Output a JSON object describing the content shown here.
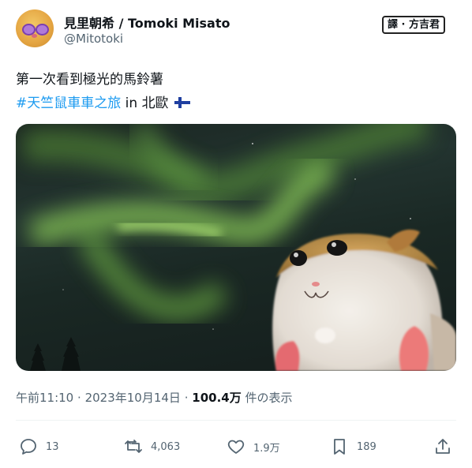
{
  "author": {
    "display_name": "見里朝希 / Tomoki Misato",
    "handle": "@Mitotoki",
    "avatar": "felt-hamster-avatar"
  },
  "translation_badge": "譯 · 方吉君",
  "post": {
    "line1": "第一次看到極光的馬鈴薯",
    "hashtag": "#天竺鼠車車之旅",
    "location_prefix": "in",
    "location": "北歐",
    "flag_icon": "finland-flag-icon"
  },
  "photo": {
    "description_icon": "aurora-photo",
    "colors": {
      "aurora": "#7ecb4d",
      "sky": "#1b2622"
    }
  },
  "meta": {
    "time": "午前11:10",
    "date": "2023年10月14日",
    "views": "100.4万",
    "views_label": "件の表示"
  },
  "actions": {
    "reply": {
      "icon": "reply-icon",
      "count": "13"
    },
    "retweet": {
      "icon": "retweet-icon",
      "count": "4,063"
    },
    "like": {
      "icon": "heart-icon",
      "count": "1.9万"
    },
    "bookmark": {
      "icon": "bookmark-icon",
      "count": "189"
    },
    "share": {
      "icon": "share-icon"
    }
  },
  "colors": {
    "link": "#1d9bf0",
    "muted": "#536471",
    "text": "#0f1419"
  }
}
